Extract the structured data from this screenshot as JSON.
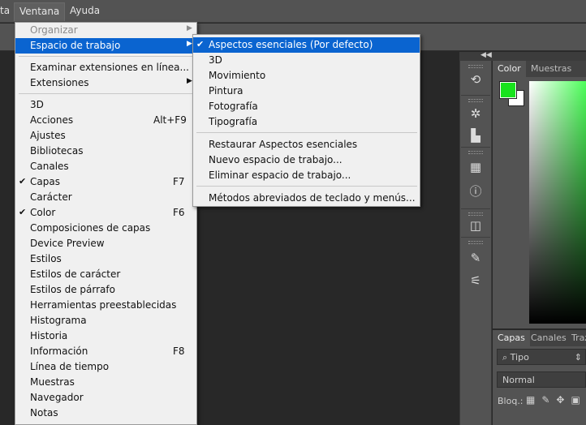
{
  "menubar": {
    "items": [
      "ta",
      "Ventana",
      "Ayuda"
    ],
    "active": "Ventana"
  },
  "window_menu": {
    "items": [
      {
        "label": "Organizar",
        "disabled": true,
        "submenu": true
      },
      {
        "label": "Espacio de trabajo",
        "highlighted": true,
        "submenu": true
      },
      {
        "label": "Examinar extensiones en línea..."
      },
      {
        "label": "Extensiones",
        "submenu": true
      },
      {
        "label": "3D"
      },
      {
        "label": "Acciones",
        "shortcut": "Alt+F9"
      },
      {
        "label": "Ajustes"
      },
      {
        "label": "Bibliotecas"
      },
      {
        "label": "Canales"
      },
      {
        "label": "Capas",
        "shortcut": "F7",
        "checked": true
      },
      {
        "label": "Carácter"
      },
      {
        "label": "Color",
        "shortcut": "F6",
        "checked": true
      },
      {
        "label": "Composiciones de capas"
      },
      {
        "label": "Device Preview"
      },
      {
        "label": "Estilos"
      },
      {
        "label": "Estilos de carácter"
      },
      {
        "label": "Estilos de párrafo"
      },
      {
        "label": "Herramientas preestablecidas"
      },
      {
        "label": "Histograma"
      },
      {
        "label": "Historia"
      },
      {
        "label": "Información",
        "shortcut": "F8"
      },
      {
        "label": "Línea de tiempo"
      },
      {
        "label": "Muestras"
      },
      {
        "label": "Navegador"
      },
      {
        "label": "Notas"
      }
    ]
  },
  "workspace_menu": {
    "items": [
      {
        "label": "Aspectos esenciales (Por defecto)",
        "checked": true,
        "highlighted": true
      },
      {
        "label": "3D"
      },
      {
        "label": "Movimiento"
      },
      {
        "label": "Pintura"
      },
      {
        "label": "Fotografía"
      },
      {
        "label": "Tipografía"
      },
      {
        "label": "Restaurar Aspectos esenciales"
      },
      {
        "label": "Nuevo espacio de trabajo..."
      },
      {
        "label": "Eliminar espacio de trabajo..."
      },
      {
        "label": "Métodos abreviados de teclado y menús..."
      }
    ]
  },
  "color_panel": {
    "tabs": [
      "Color",
      "Muestras"
    ],
    "foreground": "#18e31d",
    "background": "#ffffff"
  },
  "layers_panel": {
    "tabs": [
      "Capas",
      "Canales",
      "Traz"
    ],
    "filter_label": "Tipo",
    "blend_mode": "Normal",
    "lock_label": "Bloq.:"
  },
  "glyphs": {
    "check": "✔",
    "submenu": "▶",
    "collapse": "◀◀",
    "search": "⌕",
    "chevron": "⇕"
  },
  "colors": {
    "highlight": "#0a64d0",
    "menu_bg": "#f0f0f0",
    "chrome": "#535353"
  }
}
